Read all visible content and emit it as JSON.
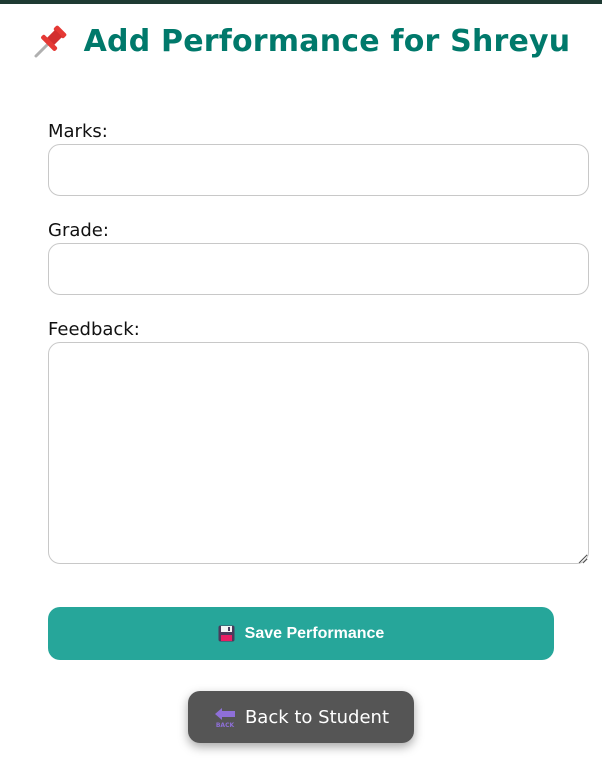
{
  "header": {
    "title": "Add Performance for Shreyu",
    "icon": "pushpin-icon",
    "title_color": "#00796b"
  },
  "form": {
    "marks": {
      "label": "Marks:",
      "value": "",
      "placeholder": ""
    },
    "grade": {
      "label": "Grade:",
      "value": "",
      "placeholder": ""
    },
    "feedback": {
      "label": "Feedback:",
      "value": "",
      "placeholder": ""
    }
  },
  "actions": {
    "save": {
      "label": "Save Performance",
      "icon": "floppy-disk-icon",
      "color": "#26a69a"
    },
    "back": {
      "label": "Back to Student",
      "icon": "back-arrow-icon",
      "color": "#555555"
    }
  }
}
